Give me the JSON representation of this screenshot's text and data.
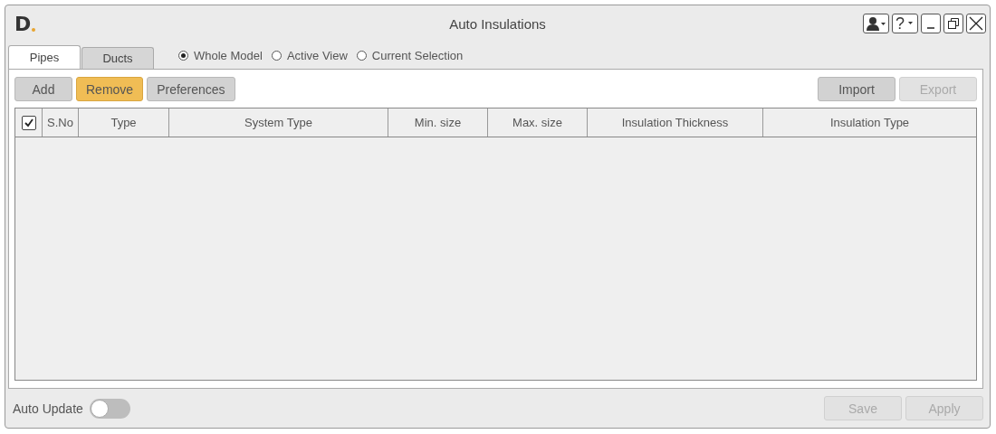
{
  "window": {
    "logo": "D",
    "title": "Auto Insulations",
    "help": "?"
  },
  "tabs": [
    {
      "label": "Pipes",
      "selected": true
    },
    {
      "label": "Ducts",
      "selected": false
    }
  ],
  "scope": [
    {
      "label": "Whole Model",
      "selected": true
    },
    {
      "label": "Active View",
      "selected": false
    },
    {
      "label": "Current Selection",
      "selected": false
    }
  ],
  "toolbar_left": [
    {
      "label": "Add",
      "highlighted": false
    },
    {
      "label": "Remove",
      "highlighted": true
    },
    {
      "label": "Preferences",
      "highlighted": false
    }
  ],
  "toolbar_right": [
    {
      "label": "Import",
      "disabled": false
    },
    {
      "label": "Export",
      "disabled": true
    }
  ],
  "table": {
    "select_all_checked": true,
    "columns": [
      "S.No",
      "Type",
      "System Type",
      "Min. size",
      "Max. size",
      "Insulation Thickness",
      "Insulation Type"
    ]
  },
  "auto_update": {
    "label": "Auto Update",
    "on": false
  },
  "footer_buttons": [
    {
      "label": "Save",
      "disabled": true
    },
    {
      "label": "Apply",
      "disabled": true
    }
  ]
}
